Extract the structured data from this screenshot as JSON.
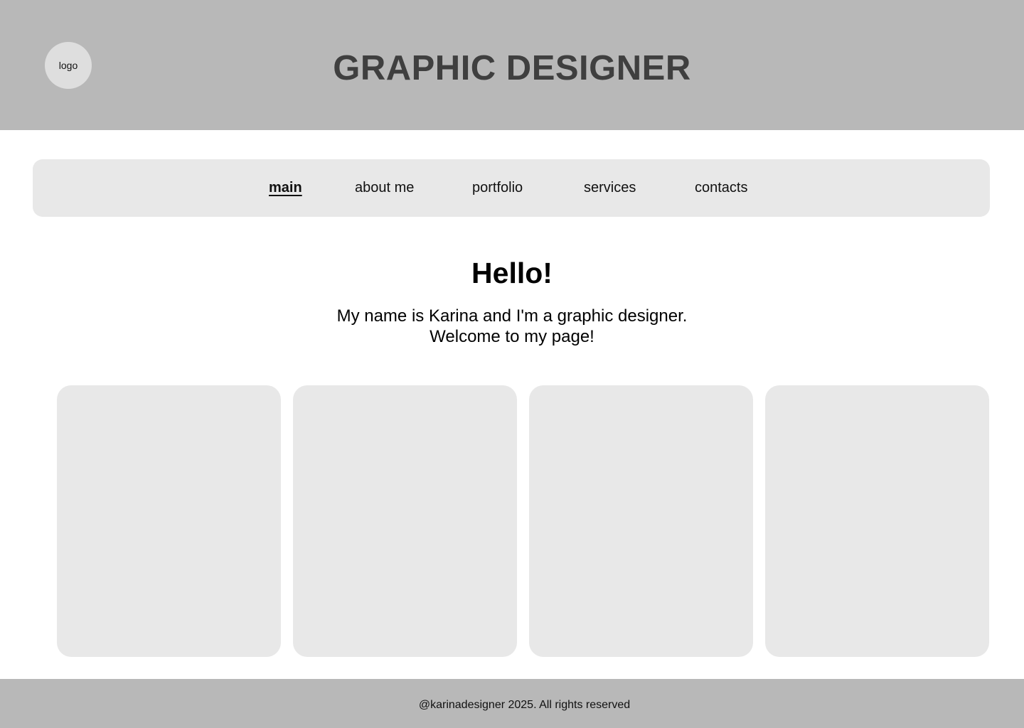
{
  "header": {
    "logo_label": "logo",
    "title": "GRAPHIC DESIGNER"
  },
  "nav": {
    "items": [
      {
        "label": "main",
        "active": true
      },
      {
        "label": "about me",
        "active": false
      },
      {
        "label": "portfolio",
        "active": false
      },
      {
        "label": "services",
        "active": false
      },
      {
        "label": "contacts",
        "active": false
      }
    ]
  },
  "intro": {
    "heading": "Hello!",
    "line1": "My name is Karina and I'm a graphic designer.",
    "line2": "Welcome to my page!"
  },
  "footer": {
    "text": "@karinadesigner 2025. All rights reserved"
  },
  "colors": {
    "header_bg": "#b8b8b8",
    "panel_bg": "#e8e8e8",
    "title_text": "#3f3f3f"
  }
}
